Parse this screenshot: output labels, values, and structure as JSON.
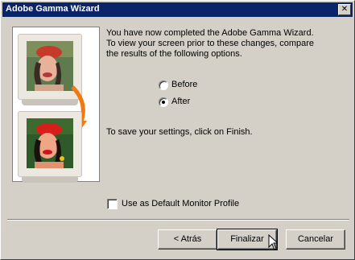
{
  "window": {
    "title": "Adobe Gamma Wizard"
  },
  "intro_text": [
    "You have now completed the Adobe Gamma Wizard.",
    "To view your screen prior to these changes, compare",
    "the results of the following options."
  ],
  "options": {
    "before_label": "Before",
    "after_label": "After",
    "selected": "After"
  },
  "finish_text": "To save your settings, click on Finish.",
  "default_profile_label": "Use as Default Monitor Profile",
  "default_profile_checked": false,
  "buttons": {
    "back": "< Atrás",
    "finish": "Finalizar",
    "cancel": "Cancelar"
  },
  "colors": {
    "titlebar": "#0a246a",
    "face": "#d4d0c8",
    "arrow": "#f07a10"
  }
}
